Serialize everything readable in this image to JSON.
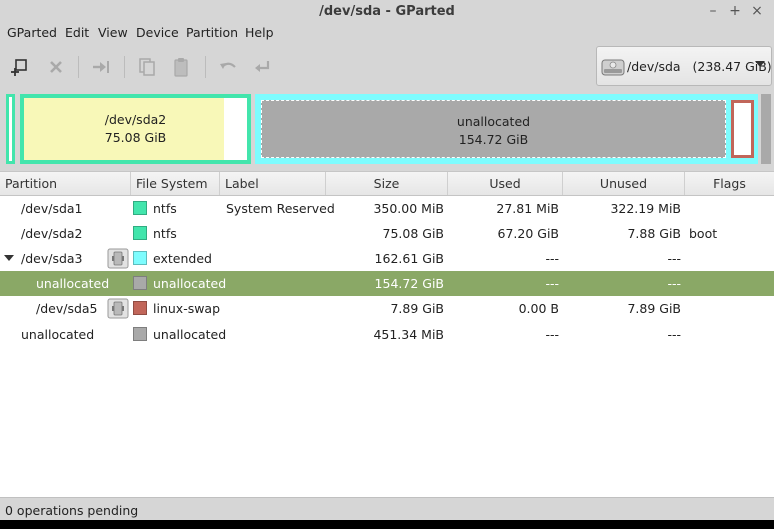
{
  "window": {
    "title": "/dev/sda - GParted",
    "minimize": "–",
    "maximize": "+",
    "close": "×"
  },
  "menu": [
    "GParted",
    "Edit",
    "View",
    "Device",
    "Partition",
    "Help"
  ],
  "toolbar": {
    "buttons": [
      "new-partition-icon",
      "delete-icon",
      "resize-move-icon",
      "copy-icon",
      "paste-icon",
      "undo-icon",
      "apply-icon"
    ]
  },
  "device_selector": {
    "device": "/dev/sda",
    "size": "(238.47 GiB)"
  },
  "disk_map": {
    "sda2": {
      "name": "/dev/sda2",
      "size": "75.08 GiB"
    },
    "unallocated": {
      "name": "unallocated",
      "size": "154.72 GiB"
    }
  },
  "table": {
    "headers": [
      "Partition",
      "File System",
      "Label",
      "Size",
      "Used",
      "Unused",
      "Flags"
    ],
    "rows": [
      {
        "partition": "/dev/sda1",
        "fs": "ntfs",
        "label": "System Reserved",
        "size": "350.00 MiB",
        "used": "27.81 MiB",
        "unused": "322.19 MiB",
        "flags": ""
      },
      {
        "partition": "/dev/sda2",
        "fs": "ntfs",
        "label": "",
        "size": "75.08 GiB",
        "used": "67.20 GiB",
        "unused": "7.88 GiB",
        "flags": "boot"
      },
      {
        "partition": "/dev/sda3",
        "fs": "extended",
        "label": "",
        "size": "162.61 GiB",
        "used": "---",
        "unused": "---",
        "flags": ""
      },
      {
        "partition": "unallocated",
        "fs": "unallocated",
        "label": "",
        "size": "154.72 GiB",
        "used": "---",
        "unused": "---",
        "flags": ""
      },
      {
        "partition": "/dev/sda5",
        "fs": "linux-swap",
        "label": "",
        "size": "7.89 GiB",
        "used": "0.00 B",
        "unused": "7.89 GiB",
        "flags": ""
      },
      {
        "partition": "unallocated",
        "fs": "unallocated",
        "label": "",
        "size": "451.34 MiB",
        "used": "---",
        "unused": "---",
        "flags": ""
      }
    ]
  },
  "colors": {
    "ntfs": "#42e5ac",
    "extended": "#7dfcfe",
    "unallocated": "#a9a9a9",
    "linux_swap": "#c1665a",
    "used_fill": "#f8f8b8",
    "selection": "#8aa866"
  },
  "status": "0 operations pending"
}
